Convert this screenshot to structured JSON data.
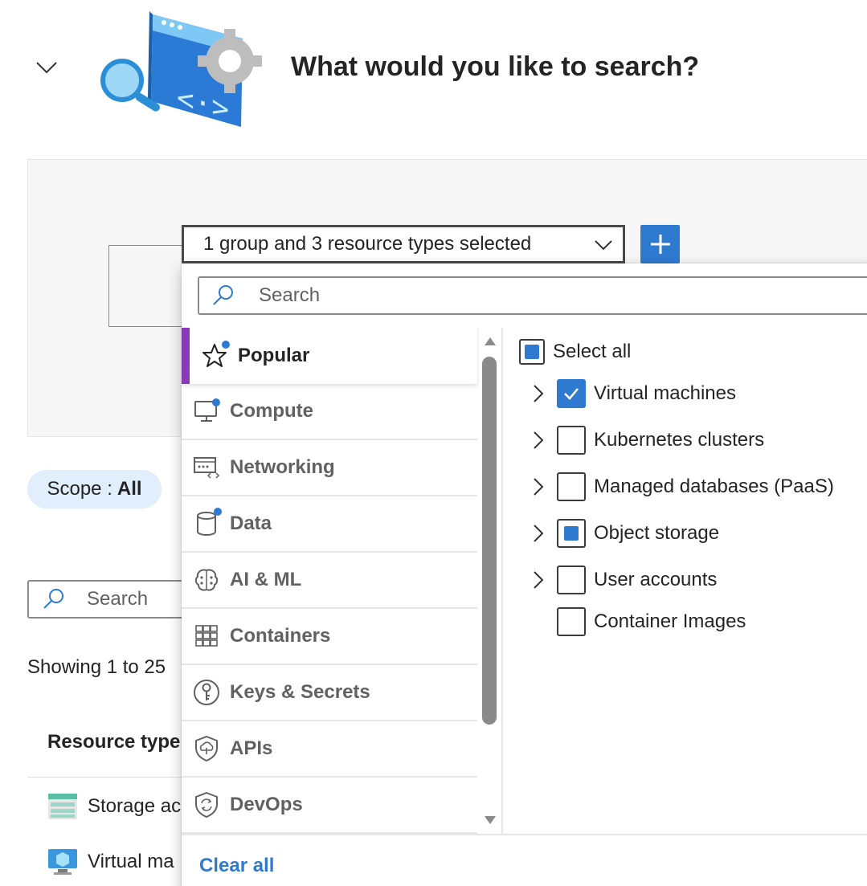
{
  "header": {
    "title": "What would you like to search?"
  },
  "query_builder": {
    "type_dropdown_value": "1 group and 3 resource types selected",
    "add_button_icon": "plus-icon"
  },
  "scope": {
    "label": "Scope :",
    "value": "All"
  },
  "results": {
    "search_placeholder": "Search",
    "showing_text": "Showing 1 to 25",
    "column_header": "Resource type",
    "rows": [
      {
        "label": "Storage ac",
        "icon": "storage-account-icon"
      },
      {
        "label": "Virtual ma",
        "icon": "virtual-machine-icon"
      }
    ]
  },
  "popup": {
    "search_placeholder": "Search",
    "categories": [
      {
        "label": "Popular",
        "icon": "star-icon",
        "active": true,
        "has_selection": true
      },
      {
        "label": "Compute",
        "icon": "monitor-icon",
        "active": false,
        "has_selection": true
      },
      {
        "label": "Networking",
        "icon": "network-icon",
        "active": false,
        "has_selection": false
      },
      {
        "label": "Data",
        "icon": "database-icon",
        "active": false,
        "has_selection": true
      },
      {
        "label": "AI & ML",
        "icon": "brain-icon",
        "active": false,
        "has_selection": false
      },
      {
        "label": "Containers",
        "icon": "containers-icon",
        "active": false,
        "has_selection": false
      },
      {
        "label": "Keys & Secrets",
        "icon": "key-icon",
        "active": false,
        "has_selection": false
      },
      {
        "label": "APIs",
        "icon": "api-shield-icon",
        "active": false,
        "has_selection": false
      },
      {
        "label": "DevOps",
        "icon": "devops-shield-icon",
        "active": false,
        "has_selection": false
      }
    ],
    "select_all": {
      "label": "Select all",
      "state": "partial"
    },
    "resource_types": [
      {
        "label": "Virtual machines",
        "state": "checked",
        "expandable": true
      },
      {
        "label": "Kubernetes clusters",
        "state": "unchecked",
        "expandable": true
      },
      {
        "label": "Managed databases (PaaS)",
        "state": "unchecked",
        "expandable": true
      },
      {
        "label": "Object storage",
        "state": "partial",
        "expandable": true
      },
      {
        "label": "User accounts",
        "state": "unchecked",
        "expandable": true
      },
      {
        "label": "Container Images",
        "state": "unchecked",
        "expandable": false
      }
    ],
    "clear_all_label": "Clear all"
  },
  "colors": {
    "accent": "#2f7ad1",
    "active_bar": "#8a3ab9",
    "scope_pill_bg": "#e1eefb"
  }
}
